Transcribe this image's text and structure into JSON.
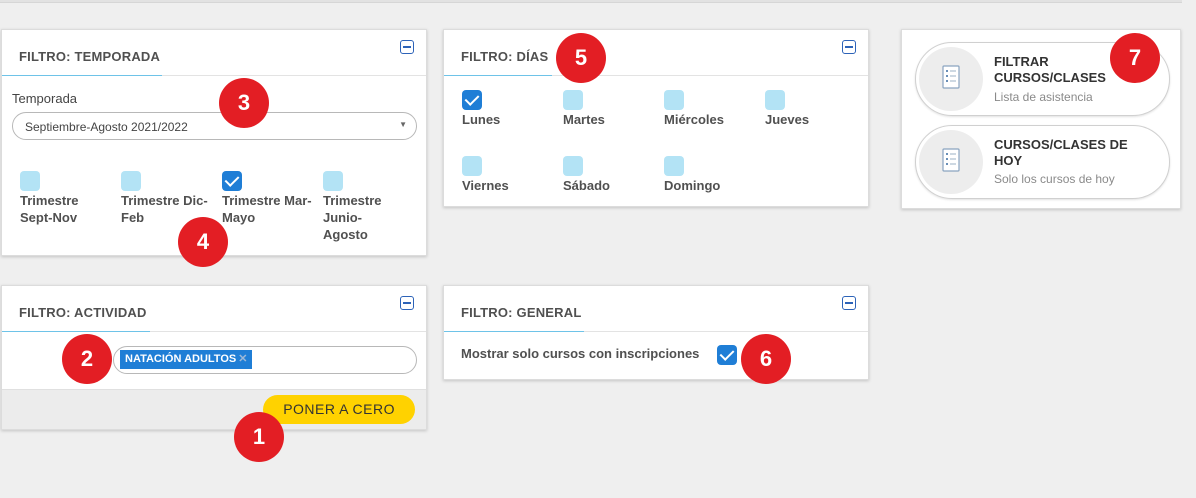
{
  "temporada_panel": {
    "title": "FILTRO: TEMPORADA",
    "field_label": "Temporada",
    "select_value": "Septiembre-Agosto 2021/2022",
    "trimestres": [
      {
        "label": "Trimestre Sept-Nov",
        "checked": false
      },
      {
        "label": "Trimestre Dic-Feb",
        "checked": false
      },
      {
        "label": "Trimestre Mar-Mayo",
        "checked": true
      },
      {
        "label": "Trimestre Junio-Agosto",
        "checked": false
      }
    ]
  },
  "dias_panel": {
    "title": "FILTRO: DÍAS",
    "days": [
      {
        "label": "Lunes",
        "checked": true
      },
      {
        "label": "Martes",
        "checked": false
      },
      {
        "label": "Miércoles",
        "checked": false
      },
      {
        "label": "Jueves",
        "checked": false
      },
      {
        "label": "Viernes",
        "checked": false
      },
      {
        "label": "Sábado",
        "checked": false
      },
      {
        "label": "Domingo",
        "checked": false
      }
    ]
  },
  "actividad_panel": {
    "title": "FILTRO: ACTIVIDAD",
    "tag": "NATACIÓN ADULTOS",
    "tag_remove": "✕",
    "reset_button": "PONER A CERO"
  },
  "general_panel": {
    "title": "FILTRO: GENERAL",
    "option_label": "Mostrar solo cursos con inscripciones",
    "option_checked": true
  },
  "actions": [
    {
      "title": "FILTRAR CURSOS/CLASES",
      "subtitle": "Lista de asistencia",
      "icon": "checklist-icon"
    },
    {
      "title": "CURSOS/CLASES DE HOY",
      "subtitle": "Solo los cursos de hoy",
      "icon": "checklist-icon"
    }
  ],
  "markers": [
    "1",
    "2",
    "3",
    "4",
    "5",
    "6",
    "7"
  ],
  "colors": {
    "accent_blue": "#1f7ed6",
    "checkbox_unchecked": "#b3e3f5",
    "reset_yellow": "#ffd200",
    "marker_red": "#e31e24"
  }
}
